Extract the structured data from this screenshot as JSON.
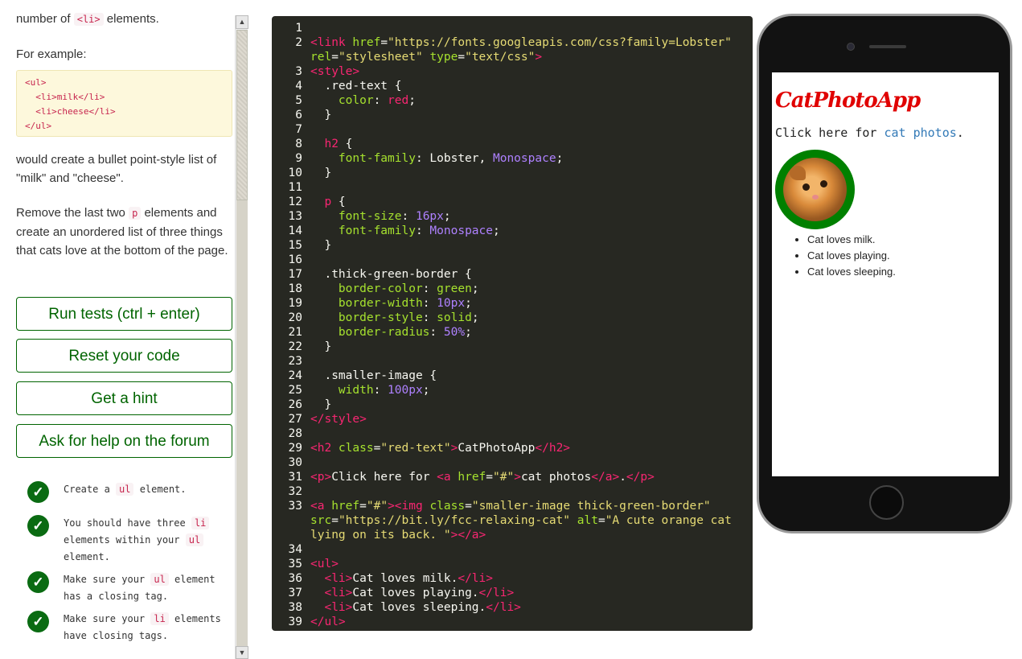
{
  "instructions": {
    "top_fragment_pre": "number of ",
    "top_fragment_code": "<li>",
    "top_fragment_post": " elements.",
    "for_example": "For example:",
    "example_code": "<ul>\n  <li>milk</li>\n  <li>cheese</li>\n</ul>",
    "bullet_text": "would create a bullet point-style list of \"milk\" and \"cheese\".",
    "task_pre": "Remove the last two ",
    "task_code": "p",
    "task_post": " elements and create an unordered list of three things that cats love at the bottom of the page."
  },
  "buttons": {
    "run": "Run tests (ctrl + enter)",
    "reset": "Reset your code",
    "hint": "Get a hint",
    "forum": "Ask for help on the forum"
  },
  "tests": [
    {
      "pre": "Create a ",
      "code": "ul",
      "post": " element."
    },
    {
      "pre": "You should have three ",
      "code": "li",
      "post": " elements within your ",
      "code2": "ul",
      "post2": " element."
    },
    {
      "pre": "Make sure your ",
      "code": "ul",
      "post": " element has a closing tag."
    },
    {
      "pre": "Make sure your ",
      "code": "li",
      "post": " elements have closing tags."
    }
  ],
  "scrollbar": {
    "up": "▲",
    "down": "▼"
  },
  "editor": {
    "line_numbers": [
      "1",
      "2",
      "",
      "3",
      "4",
      "5",
      "6",
      "7",
      "8",
      "9",
      "10",
      "11",
      "12",
      "13",
      "14",
      "15",
      "16",
      "17",
      "18",
      "19",
      "20",
      "21",
      "22",
      "23",
      "24",
      "25",
      "26",
      "27",
      "28",
      "29",
      "30",
      "31",
      "32",
      "33",
      "",
      "",
      "34",
      "35",
      "36",
      "37",
      "38",
      "39"
    ],
    "lines": [
      [],
      [
        [
          "t",
          "<link "
        ],
        [
          "a",
          "href"
        ],
        [
          "p",
          "="
        ],
        [
          "s",
          "\"https://fonts.googleapis.com/css?family=Lobster\""
        ]
      ],
      [
        [
          "a",
          "rel"
        ],
        [
          "p",
          "="
        ],
        [
          "s",
          "\"stylesheet\""
        ],
        [
          "p",
          " "
        ],
        [
          "a",
          "type"
        ],
        [
          "p",
          "="
        ],
        [
          "s",
          "\"text/css\""
        ],
        [
          "t",
          ">"
        ]
      ],
      [
        [
          "t",
          "<style>"
        ]
      ],
      [
        [
          "p",
          "  .red-text {"
        ]
      ],
      [
        [
          "a",
          "    color"
        ],
        [
          "p",
          ": "
        ],
        [
          "t",
          "red"
        ],
        [
          "p",
          ";"
        ]
      ],
      [
        [
          "p",
          "  }"
        ]
      ],
      [],
      [
        [
          "t",
          "  h2"
        ],
        [
          "p",
          " {"
        ]
      ],
      [
        [
          "a",
          "    font-family"
        ],
        [
          "p",
          ": Lobster, "
        ],
        [
          "n",
          "Monospace"
        ],
        [
          "p",
          ";"
        ]
      ],
      [
        [
          "p",
          "  }"
        ]
      ],
      [],
      [
        [
          "t",
          "  p"
        ],
        [
          "p",
          " {"
        ]
      ],
      [
        [
          "a",
          "    font-size"
        ],
        [
          "p",
          ": "
        ],
        [
          "n",
          "16px"
        ],
        [
          "p",
          ";"
        ]
      ],
      [
        [
          "a",
          "    font-family"
        ],
        [
          "p",
          ": "
        ],
        [
          "n",
          "Monospace"
        ],
        [
          "p",
          ";"
        ]
      ],
      [
        [
          "p",
          "  }"
        ]
      ],
      [],
      [
        [
          "p",
          "  .thick-green-border {"
        ]
      ],
      [
        [
          "a",
          "    border-color"
        ],
        [
          "p",
          ": "
        ],
        [
          "a",
          "green"
        ],
        [
          "p",
          ";"
        ]
      ],
      [
        [
          "a",
          "    border-width"
        ],
        [
          "p",
          ": "
        ],
        [
          "n",
          "10px"
        ],
        [
          "p",
          ";"
        ]
      ],
      [
        [
          "a",
          "    border-style"
        ],
        [
          "p",
          ": "
        ],
        [
          "a",
          "solid"
        ],
        [
          "p",
          ";"
        ]
      ],
      [
        [
          "a",
          "    border-radius"
        ],
        [
          "p",
          ": "
        ],
        [
          "n",
          "50%"
        ],
        [
          "p",
          ";"
        ]
      ],
      [
        [
          "p",
          "  }"
        ]
      ],
      [],
      [
        [
          "p",
          "  .smaller-image {"
        ]
      ],
      [
        [
          "a",
          "    width"
        ],
        [
          "p",
          ": "
        ],
        [
          "n",
          "100px"
        ],
        [
          "p",
          ";"
        ]
      ],
      [
        [
          "p",
          "  }"
        ]
      ],
      [
        [
          "t",
          "</style>"
        ]
      ],
      [],
      [
        [
          "t",
          "<h2 "
        ],
        [
          "a",
          "class"
        ],
        [
          "p",
          "="
        ],
        [
          "s",
          "\"red-text\""
        ],
        [
          "t",
          ">"
        ],
        [
          "p",
          "CatPhotoApp"
        ],
        [
          "t",
          "</h2>"
        ]
      ],
      [],
      [
        [
          "t",
          "<p>"
        ],
        [
          "p",
          "Click here for "
        ],
        [
          "t",
          "<a "
        ],
        [
          "a",
          "href"
        ],
        [
          "p",
          "="
        ],
        [
          "s",
          "\"#\""
        ],
        [
          "t",
          ">"
        ],
        [
          "p",
          "cat photos"
        ],
        [
          "t",
          "</a>"
        ],
        [
          "p",
          "."
        ],
        [
          "t",
          "</p>"
        ]
      ],
      [],
      [
        [
          "t",
          "<a "
        ],
        [
          "a",
          "href"
        ],
        [
          "p",
          "="
        ],
        [
          "s",
          "\"#\""
        ],
        [
          "t",
          ">"
        ],
        [
          "t",
          "<img "
        ],
        [
          "a",
          "class"
        ],
        [
          "p",
          "="
        ],
        [
          "s",
          "\"smaller-image thick-green-border\""
        ]
      ],
      [
        [
          "a",
          "src"
        ],
        [
          "p",
          "="
        ],
        [
          "s",
          "\"https://bit.ly/fcc-relaxing-cat\""
        ],
        [
          "p",
          " "
        ],
        [
          "a",
          "alt"
        ],
        [
          "p",
          "="
        ],
        [
          "s",
          "\"A cute orange cat"
        ]
      ],
      [
        [
          "s",
          "lying on its back. \""
        ],
        [
          "t",
          ">"
        ],
        [
          "t",
          "</a>"
        ]
      ],
      [],
      [
        [
          "t",
          "<ul>"
        ]
      ],
      [
        [
          "t",
          "  <li>"
        ],
        [
          "p",
          "Cat loves milk."
        ],
        [
          "t",
          "</li>"
        ]
      ],
      [
        [
          "t",
          "  <li>"
        ],
        [
          "p",
          "Cat loves playing."
        ],
        [
          "t",
          "</li>"
        ]
      ],
      [
        [
          "t",
          "  <li>"
        ],
        [
          "p",
          "Cat loves sleeping."
        ],
        [
          "t",
          "</li>"
        ]
      ],
      [
        [
          "t",
          "</ul>"
        ]
      ]
    ]
  },
  "preview": {
    "title": "CatPhotoApp",
    "p_pre": "Click here for ",
    "p_link": "cat photos",
    "p_post": ".",
    "img_alt": "A cute orange cat lying on its back.",
    "list": [
      "Cat loves milk.",
      "Cat loves playing.",
      "Cat loves sleeping."
    ]
  },
  "colors": {
    "editor_bg": "#272822",
    "tag": "#f92672",
    "attr": "#a6e22e",
    "string": "#e6db74",
    "number": "#ae81ff",
    "button_green": "#006400",
    "check_green": "#0a6b12",
    "preview_title": "#e00000"
  }
}
